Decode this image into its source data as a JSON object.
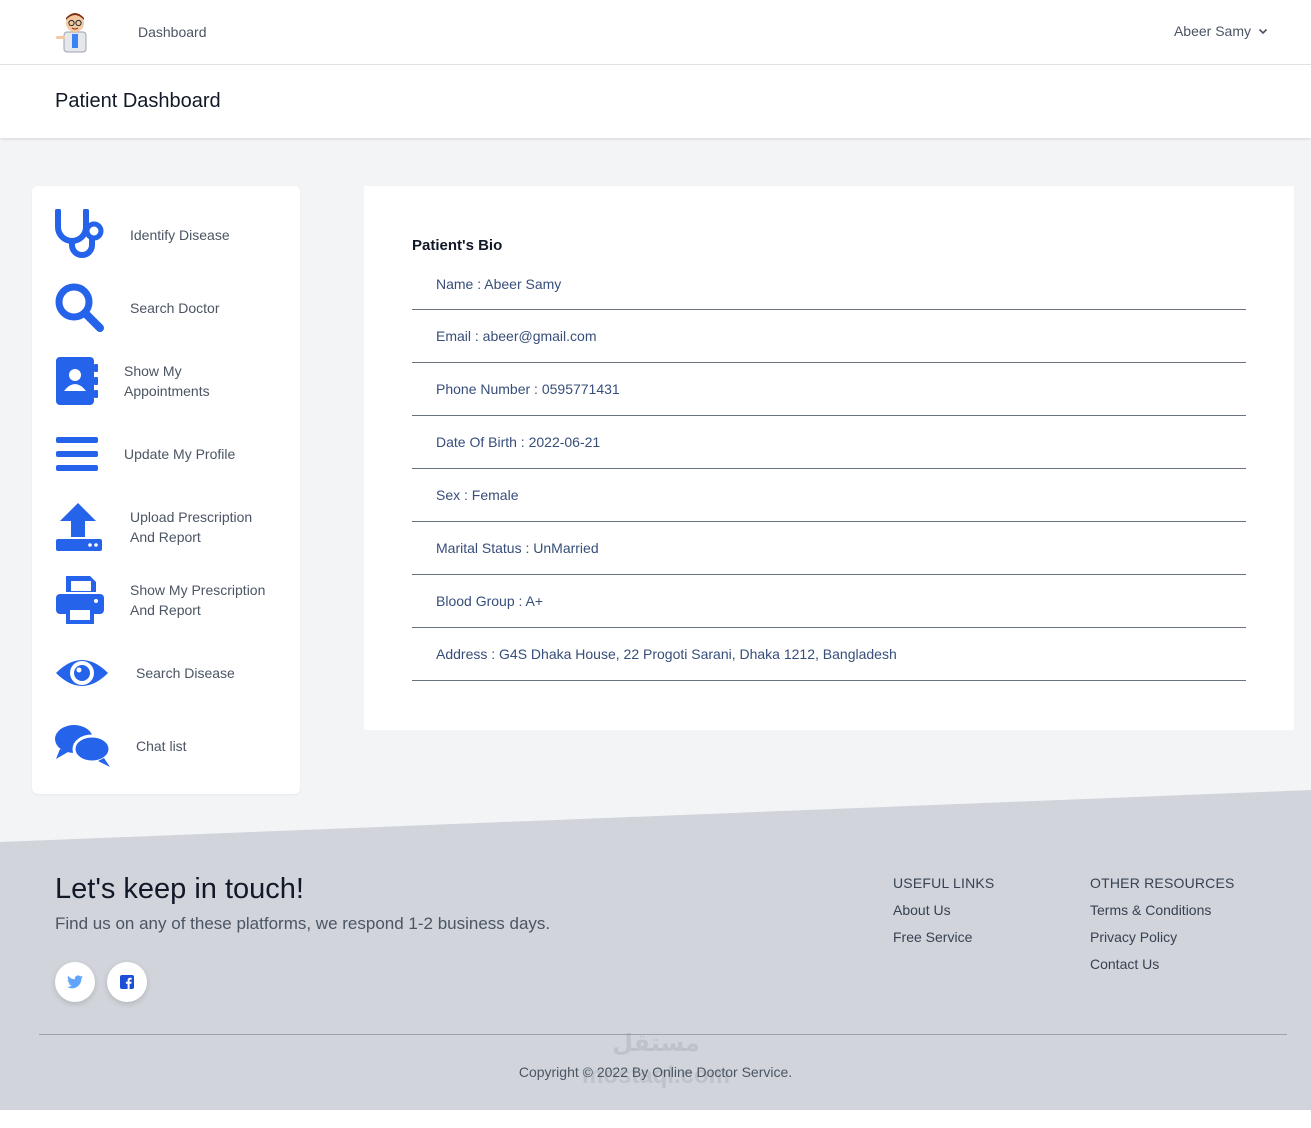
{
  "navbar": {
    "dashboard_link": "Dashboard",
    "user_name": "Abeer Samy"
  },
  "page": {
    "title": "Patient Dashboard"
  },
  "sidebar": {
    "items": [
      {
        "label": "Identify Disease",
        "icon": "stethoscope-icon"
      },
      {
        "label": "Search Doctor",
        "icon": "search-icon"
      },
      {
        "label": "Show My Appointments",
        "icon": "address-book-icon"
      },
      {
        "label": "Update My Profile",
        "icon": "menu-bars-icon"
      },
      {
        "label": "Upload Prescription And Report",
        "icon": "upload-icon"
      },
      {
        "label": "Show My Prescription And Report",
        "icon": "printer-icon"
      },
      {
        "label": "Search Disease",
        "icon": "eye-icon"
      },
      {
        "label": "Chat list",
        "icon": "chat-bubbles-icon"
      }
    ]
  },
  "bio": {
    "title": "Patient's Bio",
    "rows": [
      "Name : Abeer Samy",
      "Email : abeer@gmail.com",
      "Phone Number : 0595771431",
      "Date Of Birth : 2022-06-21",
      "Sex : Female",
      "Marital Status : UnMarried",
      "Blood Group : A+",
      "Address : G4S Dhaka House, 22 Progoti Sarani, Dhaka 1212, Bangladesh"
    ]
  },
  "footer": {
    "title": "Let's keep in touch!",
    "subtitle": "Find us on any of these platforms, we respond 1-2 business days.",
    "useful_links": {
      "heading": "USEFUL LINKS",
      "links": [
        "About Us",
        "Free Service"
      ]
    },
    "other_resources": {
      "heading": "OTHER RESOURCES",
      "links": [
        "Terms & Conditions",
        "Privacy Policy",
        "Contact Us"
      ]
    },
    "copyright": "Copyright © 2022 By Online Doctor Service.",
    "watermark": "مستقل mostaql.com"
  },
  "colors": {
    "accent": "#2563eb",
    "footer_bg": "#d1d5db",
    "page_bg": "#f3f4f6",
    "twitter": "#60a5fa",
    "facebook": "#1d4ed8"
  }
}
